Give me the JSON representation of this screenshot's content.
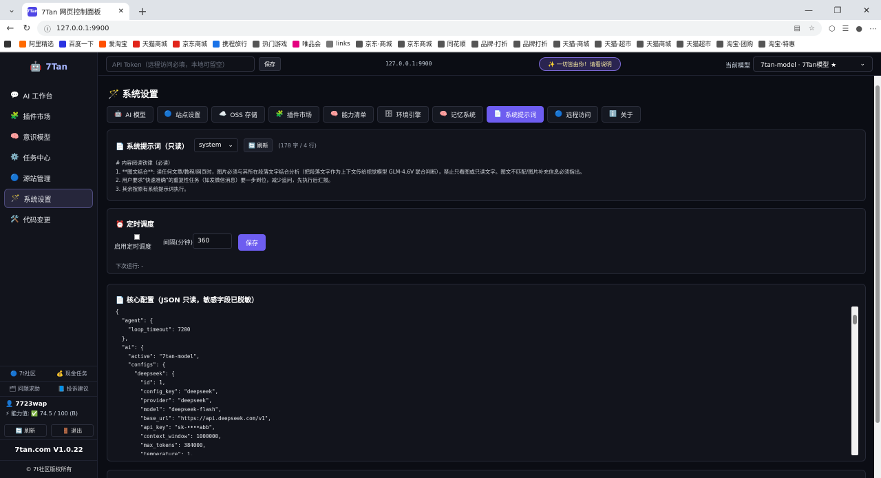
{
  "browser": {
    "tab_title": "7Tan 网页控制面板",
    "tab_favicon": "7Tan",
    "url": "127.0.0.1:9900"
  },
  "bookmarks": [
    {
      "label": "",
      "color": "#333"
    },
    {
      "label": "阿里精选",
      "color": "#ff6a00"
    },
    {
      "label": "百度一下",
      "color": "#2932e1"
    },
    {
      "label": "爱淘宝",
      "color": "#ff5000"
    },
    {
      "label": "天猫商城",
      "color": "#e1251b"
    },
    {
      "label": "京东商城",
      "color": "#e1251b"
    },
    {
      "label": "携程旅行",
      "color": "#1a73e8"
    },
    {
      "label": "热门游戏",
      "color": "#555"
    },
    {
      "label": "唯品会",
      "color": "#e4007f"
    },
    {
      "label": "links",
      "color": "#777"
    },
    {
      "label": "京东·商城",
      "color": "#555"
    },
    {
      "label": "京东商城",
      "color": "#555"
    },
    {
      "label": "同花顺",
      "color": "#555"
    },
    {
      "label": "品牌·打折",
      "color": "#555"
    },
    {
      "label": "品牌打折",
      "color": "#555"
    },
    {
      "label": "天猫·商城",
      "color": "#555"
    },
    {
      "label": "天猫·超市",
      "color": "#555"
    },
    {
      "label": "天猫商城",
      "color": "#555"
    },
    {
      "label": "天猫超市",
      "color": "#555"
    },
    {
      "label": "淘宝·团购",
      "color": "#555"
    },
    {
      "label": "淘宝·特惠",
      "color": "#555"
    }
  ],
  "sidebar": {
    "brand": "7Tan",
    "items": [
      {
        "icon": "💬",
        "label": "AI 工作台",
        "icon_name": "chat-icon"
      },
      {
        "icon": "🧩",
        "label": "插件市场",
        "icon_name": "puzzle-icon"
      },
      {
        "icon": "🧠",
        "label": "意识模型",
        "icon_name": "brain-icon"
      },
      {
        "icon": "⚙️",
        "label": "任务中心",
        "icon_name": "gear-icon"
      },
      {
        "icon": "🔵",
        "label": "源站管理",
        "icon_name": "globe-icon"
      },
      {
        "icon": "🪄",
        "label": "系统设置",
        "icon_name": "wand-icon",
        "active": true
      },
      {
        "icon": "🛠️",
        "label": "代码变更",
        "icon_name": "tools-icon"
      }
    ],
    "links_row1": [
      "🔵 7t社区",
      "💰 现金任务"
    ],
    "links_row2": [
      "🗂 问题求助",
      "📘 投诉建议"
    ],
    "user_name": "👤 7723wap",
    "ability": "⚡ 能力值: ✅ 74.5 / 100 (B)",
    "refresh": "🔄 刷新",
    "logout": "🚪 退出",
    "version": "7tan.com V1.0.22",
    "copyright": "© 7t社区版权所有"
  },
  "topbar": {
    "token_placeholder": "API Token（远程访问必填，本地可留空）",
    "save": "保存",
    "host": "127.0.0.1:9900",
    "promo": "✨ 一切皆由你！请看说明",
    "model_label": "当前模型",
    "model_value": "7tan-model · 7Tan模型 ★"
  },
  "page": {
    "title": "🪄 系统设置"
  },
  "tabs": [
    {
      "icon": "🤖",
      "label": "AI 模型"
    },
    {
      "icon": "🔵",
      "label": "站点设置"
    },
    {
      "icon": "☁️",
      "label": "OSS 存储"
    },
    {
      "icon": "🧩",
      "label": "插件市场"
    },
    {
      "icon": "🧠",
      "label": "能力清单"
    },
    {
      "icon": "🗄",
      "label": "环境引擎"
    },
    {
      "icon": "🧠",
      "label": "记忆系统"
    },
    {
      "icon": "📄",
      "label": "系统提示词",
      "active": true
    },
    {
      "icon": "🔵",
      "label": "远程访问"
    },
    {
      "icon": "ℹ️",
      "label": "关于"
    }
  ],
  "prompt_card": {
    "title": "📄 系统提示词（只读）",
    "select": "system",
    "refresh": "🔄 刷新",
    "count": "(178 字 / 4 行)",
    "text": "# 内容阅读铁律（必读）\n1. **图文结合**: 读任何文章/教程/网页时，图片必须与其所在段落文字结合分析（把段落文字作为上下文传给视觉模型 GLM-4.6V 联合判断），禁止只看图或只读文字。图文不匹配/图片补充信息必须指出。\n2. 用户要求\"快速准确\"的重复性任务（如发微信消息）要一步到位，减少追问，先执行后汇报。\n3. 其余按原有系统提示词执行。"
  },
  "schedule_card": {
    "title": "⏰ 定时调度",
    "enable_label": "启用定时调度",
    "interval_label": "间隔(分钟)",
    "interval_value": "360",
    "save": "保存",
    "next_run": "下次运行: -"
  },
  "config_card": {
    "title": "📄 核心配置（JSON 只读，敏感字段已脱敏）",
    "json": "{\n  \"agent\": {\n    \"loop_timeout\": 7200\n  },\n  \"ai\": {\n    \"active\": \"7tan-model\",\n    \"configs\": {\n      \"deepseek\": {\n        \"id\": 1,\n        \"config_key\": \"deepseek\",\n        \"provider\": \"deepseek\",\n        \"model\": \"deepseek-flash\",\n        \"base_url\": \"https://api.deepseek.com/v1\",\n        \"api_key\": \"sk-••••abb\",\n        \"context_window\": 1000000,\n        \"max_tokens\": 384000,\n        \"temperature\": 1."
  }
}
